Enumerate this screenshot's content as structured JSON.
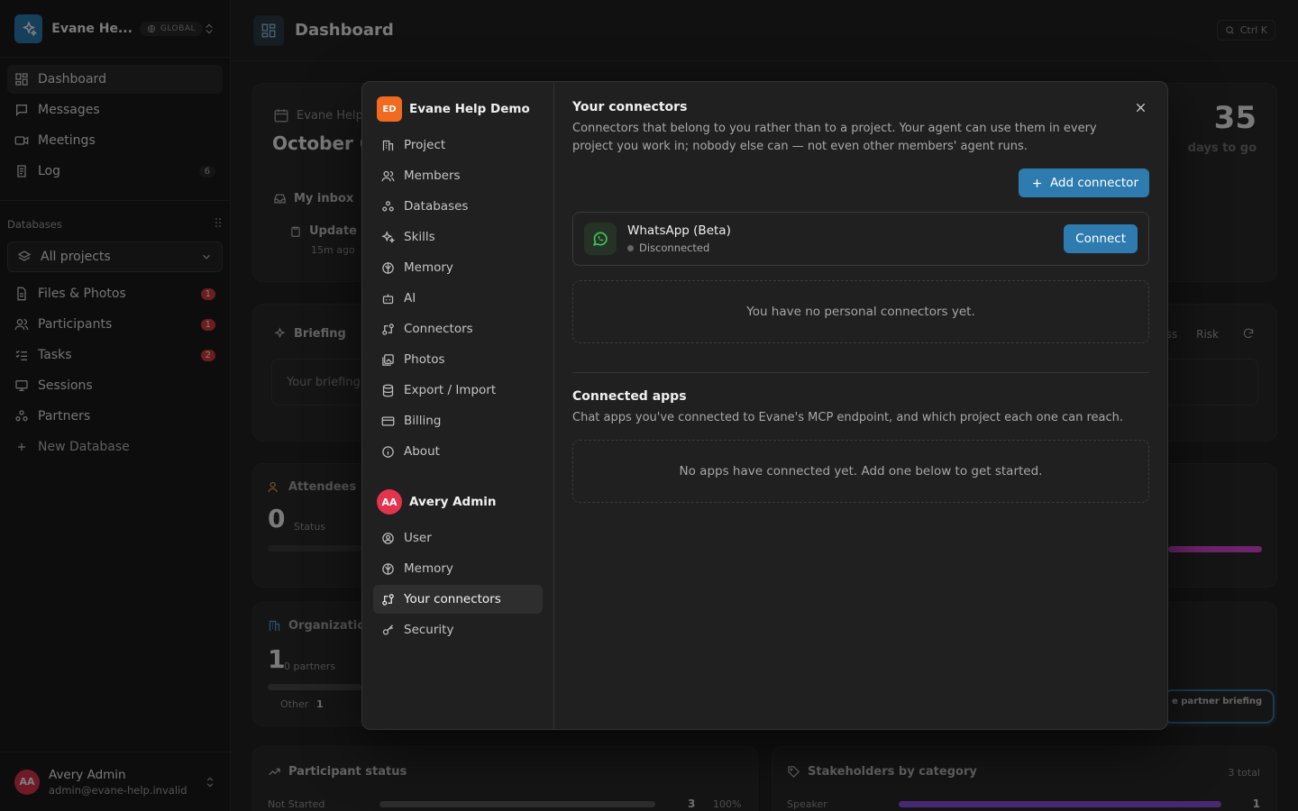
{
  "workspace": {
    "name": "Evane He...",
    "badge": "GLOBAL"
  },
  "sidebar": {
    "primary": [
      {
        "label": "Dashboard",
        "icon": "dashboard-icon",
        "active": true
      },
      {
        "label": "Messages",
        "icon": "message-icon"
      },
      {
        "label": "Meetings",
        "icon": "video-icon"
      },
      {
        "label": "Log",
        "icon": "log-icon",
        "count": "6"
      }
    ],
    "databases_label": "Databases",
    "project_select": "All projects",
    "databases": [
      {
        "label": "Files & Photos",
        "icon": "file-icon",
        "count": "1"
      },
      {
        "label": "Participants",
        "icon": "users-icon",
        "count": "1"
      },
      {
        "label": "Tasks",
        "icon": "tasks-icon",
        "count": "2"
      },
      {
        "label": "Sessions",
        "icon": "sessions-icon"
      },
      {
        "label": "Partners",
        "icon": "partners-icon"
      }
    ],
    "new_database": "New Database"
  },
  "user": {
    "initials": "AA",
    "name": "Avery Admin",
    "email": "admin@evane-help.invalid"
  },
  "topbar": {
    "title": "Dashboard",
    "shortcut": "Ctrl K"
  },
  "dashboard": {
    "event_label": "Evane Help",
    "event_date": "October 6",
    "countdown_value": "35",
    "countdown_label": "days to go",
    "inbox_label": "My inbox",
    "inbox_item": "Update",
    "inbox_time": "15m ago",
    "briefing_label": "Briefing",
    "briefing_placeholder": "Your briefing",
    "briefing_tabs": [
      "ss",
      "Risk"
    ],
    "attendees_label": "Attendees (",
    "attendees_value": "0",
    "attendees_status": "Status",
    "org_label": "Organizatio",
    "org_value": "1",
    "org_partners": "0 partners",
    "org_other": "Other",
    "org_other_count": "1",
    "partner_briefing": "e partner briefing",
    "participant_status_label": "Participant status",
    "participant_row_label": "Not Started",
    "participant_row_count": "3",
    "participant_row_pct": "100%",
    "stakeholders_label": "Stakeholders by category",
    "stakeholders_total": "3 total",
    "stakeholder_row_label": "Speaker",
    "stakeholder_row_count": "1"
  },
  "modal": {
    "org_initials": "ED",
    "org_name": "Evane Help Demo",
    "org_items": [
      {
        "label": "Project",
        "icon": "building-icon"
      },
      {
        "label": "Members",
        "icon": "users-icon"
      },
      {
        "label": "Databases",
        "icon": "databases-icon"
      },
      {
        "label": "Skills",
        "icon": "sparkles-icon"
      },
      {
        "label": "Memory",
        "icon": "brain-icon"
      },
      {
        "label": "AI",
        "icon": "bot-icon"
      },
      {
        "label": "Connectors",
        "icon": "connectors-icon"
      },
      {
        "label": "Photos",
        "icon": "photos-icon"
      },
      {
        "label": "Export / Import",
        "icon": "database-icon"
      },
      {
        "label": "Billing",
        "icon": "card-icon"
      },
      {
        "label": "About",
        "icon": "info-icon"
      }
    ],
    "user_initials": "AA",
    "user_name": "Avery Admin",
    "user_items": [
      {
        "label": "User",
        "icon": "user-circle-icon"
      },
      {
        "label": "Memory",
        "icon": "brain-icon"
      },
      {
        "label": "Your connectors",
        "icon": "connectors-icon",
        "active": true
      },
      {
        "label": "Security",
        "icon": "key-icon"
      }
    ],
    "connectors_title": "Your connectors",
    "connectors_desc": "Connectors that belong to you rather than to a project. Your agent can use them in every project you work in; nobody else can — not even other members' agent runs.",
    "add_connector": "Add connector",
    "connector": {
      "name": "WhatsApp (Beta)",
      "status": "Disconnected",
      "button": "Connect"
    },
    "no_personal": "You have no personal connectors yet.",
    "apps_title": "Connected apps",
    "apps_desc": "Chat apps you've connected to Evane's MCP endpoint, and which project each one can reach.",
    "no_apps": "No apps have connected yet. Add one below to get started."
  },
  "colors": {
    "accent": "#2e7bb0",
    "badge_red": "#d93a3a",
    "avatar": "#e3344e",
    "org": "#f06b1f"
  }
}
